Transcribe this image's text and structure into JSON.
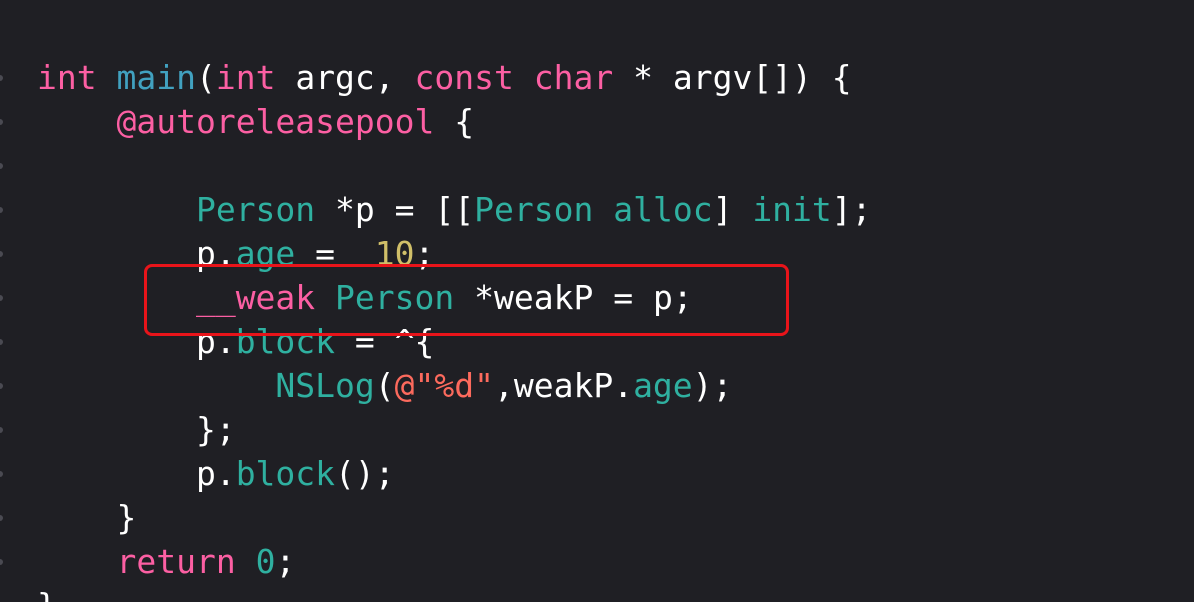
{
  "editor": {
    "lines": [
      {
        "id": "l1",
        "tokens": [
          {
            "t": "int",
            "c": "kw"
          },
          {
            "t": " ",
            "c": "pl"
          },
          {
            "t": "main",
            "c": "cls"
          },
          {
            "t": "(",
            "c": "pl"
          },
          {
            "t": "int",
            "c": "kw"
          },
          {
            "t": " argc, ",
            "c": "pl"
          },
          {
            "t": "const",
            "c": "kw"
          },
          {
            "t": " ",
            "c": "pl"
          },
          {
            "t": "char",
            "c": "kw"
          },
          {
            "t": " * argv[]) {",
            "c": "pl"
          }
        ]
      },
      {
        "id": "l2",
        "tokens": [
          {
            "t": "    ",
            "c": "pl"
          },
          {
            "t": "@autoreleasepool",
            "c": "kw"
          },
          {
            "t": " {",
            "c": "pl"
          }
        ]
      },
      {
        "id": "l3",
        "tokens": [
          {
            "t": "",
            "c": "pl"
          }
        ]
      },
      {
        "id": "l4",
        "tokens": [
          {
            "t": "        ",
            "c": "pl"
          },
          {
            "t": "Person",
            "c": "tl"
          },
          {
            "t": " *p = [[",
            "c": "pl"
          },
          {
            "t": "Person",
            "c": "tl"
          },
          {
            "t": " ",
            "c": "pl"
          },
          {
            "t": "alloc",
            "c": "tl"
          },
          {
            "t": "] ",
            "c": "pl"
          },
          {
            "t": "init",
            "c": "tl"
          },
          {
            "t": "];",
            "c": "pl"
          }
        ]
      },
      {
        "id": "l5",
        "tokens": [
          {
            "t": "        p.",
            "c": "pl"
          },
          {
            "t": "age",
            "c": "tl"
          },
          {
            "t": " =  ",
            "c": "pl"
          },
          {
            "t": "10",
            "c": "num"
          },
          {
            "t": ";",
            "c": "pl"
          }
        ]
      },
      {
        "id": "l6",
        "tokens": [
          {
            "t": "        ",
            "c": "pl"
          },
          {
            "t": "__weak",
            "c": "kw"
          },
          {
            "t": " ",
            "c": "pl"
          },
          {
            "t": "Person",
            "c": "tl"
          },
          {
            "t": " *weakP = p;",
            "c": "pl"
          }
        ]
      },
      {
        "id": "l7",
        "tokens": [
          {
            "t": "        p.",
            "c": "pl"
          },
          {
            "t": "block",
            "c": "tl"
          },
          {
            "t": " = ^{",
            "c": "pl"
          }
        ]
      },
      {
        "id": "l8",
        "tokens": [
          {
            "t": "            ",
            "c": "pl"
          },
          {
            "t": "NSLog",
            "c": "tl"
          },
          {
            "t": "(",
            "c": "pl"
          },
          {
            "t": "@\"%d\"",
            "c": "str"
          },
          {
            "t": ",weakP.",
            "c": "pl"
          },
          {
            "t": "age",
            "c": "tl"
          },
          {
            "t": ");",
            "c": "pl"
          }
        ]
      },
      {
        "id": "l9",
        "tokens": [
          {
            "t": "        };",
            "c": "pl"
          }
        ]
      },
      {
        "id": "l10",
        "tokens": [
          {
            "t": "        p.",
            "c": "pl"
          },
          {
            "t": "block",
            "c": "tl"
          },
          {
            "t": "();",
            "c": "pl"
          }
        ]
      },
      {
        "id": "l11",
        "tokens": [
          {
            "t": "    }",
            "c": "pl"
          }
        ]
      },
      {
        "id": "l12",
        "tokens": [
          {
            "t": "    ",
            "c": "pl"
          },
          {
            "t": "return",
            "c": "kw"
          },
          {
            "t": " ",
            "c": "pl"
          },
          {
            "t": "0",
            "c": "tl"
          },
          {
            "t": ";",
            "c": "pl"
          }
        ]
      },
      {
        "id": "l13",
        "tokens": [
          {
            "t": "}",
            "c": "pl"
          }
        ]
      }
    ]
  },
  "colors": {
    "background": "#1f1f24",
    "keyword": "#fc5fa3",
    "identifier": "#2fb0a0",
    "string": "#fc6a5d",
    "number": "#d0bf69",
    "plain": "#ffffff",
    "highlight_border": "#e8141a"
  }
}
